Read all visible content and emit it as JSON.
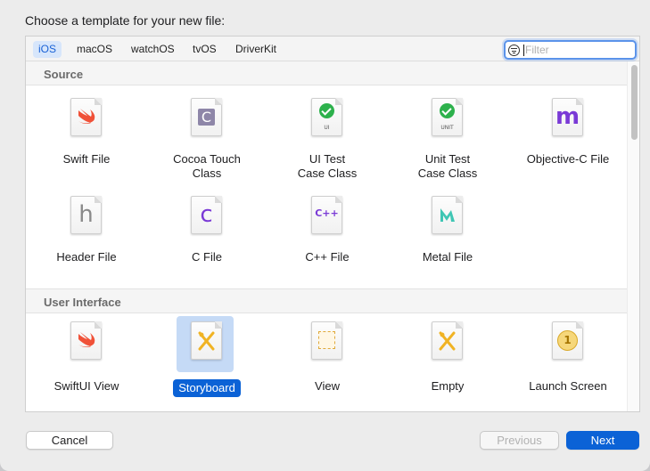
{
  "dialog": {
    "heading": "Choose a template for your new file:"
  },
  "tabs": [
    {
      "label": "iOS",
      "active": true
    },
    {
      "label": "macOS",
      "active": false
    },
    {
      "label": "watchOS",
      "active": false
    },
    {
      "label": "tvOS",
      "active": false
    },
    {
      "label": "DriverKit",
      "active": false
    }
  ],
  "filter": {
    "placeholder": "Filter",
    "value": ""
  },
  "sections": {
    "source": {
      "title": "Source",
      "items": [
        {
          "line1": "Swift File",
          "line2": "",
          "icon": "swift-icon"
        },
        {
          "line1": "Cocoa Touch",
          "line2": "Class",
          "icon": "cocoa-class-icon",
          "glyph": "C"
        },
        {
          "line1": "UI Test",
          "line2": "Case Class",
          "icon": "ui-test-icon",
          "sub": "UI"
        },
        {
          "line1": "Unit Test",
          "line2": "Case Class",
          "icon": "unit-test-icon",
          "sub": "UNIT"
        },
        {
          "line1": "Objective-C File",
          "line2": "",
          "icon": "objc-icon",
          "glyph": "m"
        },
        {
          "line1": "Header File",
          "line2": "",
          "icon": "header-icon",
          "glyph": "h"
        },
        {
          "line1": "C File",
          "line2": "",
          "icon": "c-file-icon",
          "glyph": "c"
        },
        {
          "line1": "C++ File",
          "line2": "",
          "icon": "cpp-file-icon",
          "glyph": "C++"
        },
        {
          "line1": "Metal File",
          "line2": "",
          "icon": "metal-icon"
        }
      ]
    },
    "user_interface": {
      "title": "User Interface",
      "items": [
        {
          "line1": "SwiftUI View",
          "icon": "swift-icon"
        },
        {
          "line1": "Storyboard",
          "icon": "storyboard-icon",
          "selected": true
        },
        {
          "line1": "View",
          "icon": "view-icon"
        },
        {
          "line1": "Empty",
          "icon": "empty-icon"
        },
        {
          "line1": "Launch Screen",
          "icon": "launch-screen-icon",
          "glyph": "1"
        }
      ]
    }
  },
  "buttons": {
    "cancel": "Cancel",
    "previous": "Previous",
    "next": "Next"
  },
  "colors": {
    "accent": "#0b62d6",
    "swift": "#f05138",
    "check": "#2db14c",
    "purple": "#7a3ad6"
  }
}
